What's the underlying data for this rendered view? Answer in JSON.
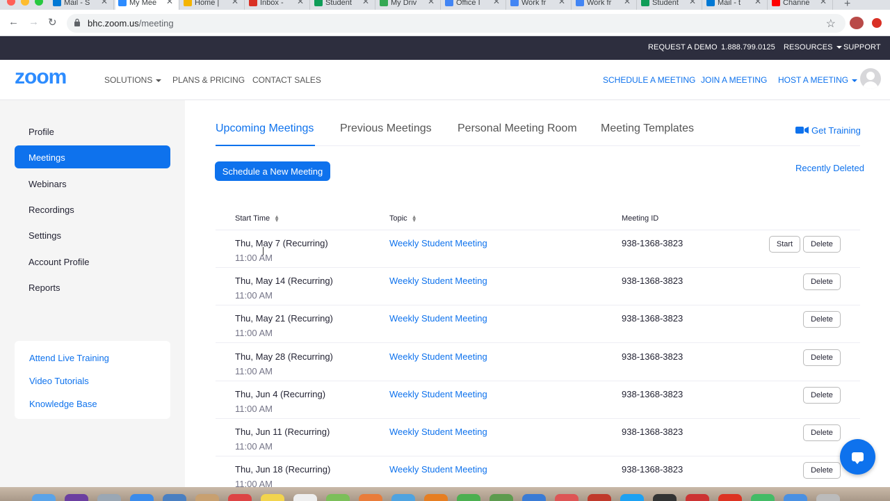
{
  "browser": {
    "tabs": [
      {
        "label": "Mail - S",
        "fav_color": "#0078d4",
        "active": false
      },
      {
        "label": "My Mee",
        "fav_color": "#2d8cff",
        "active": true
      },
      {
        "label": "Home |",
        "fav_color": "#f4b400",
        "active": false
      },
      {
        "label": "Inbox -",
        "fav_color": "#d93025",
        "active": false
      },
      {
        "label": "Student",
        "fav_color": "#0f9d58",
        "active": false
      },
      {
        "label": "My Driv",
        "fav_color": "#34a853",
        "active": false
      },
      {
        "label": "Office I",
        "fav_color": "#4285f4",
        "active": false
      },
      {
        "label": "Work fr",
        "fav_color": "#4285f4",
        "active": false
      },
      {
        "label": "Work fr",
        "fav_color": "#4285f4",
        "active": false
      },
      {
        "label": "Student",
        "fav_color": "#0f9d58",
        "active": false
      },
      {
        "label": "Mail - t",
        "fav_color": "#0078d4",
        "active": false
      },
      {
        "label": "Channe",
        "fav_color": "#ff0000",
        "active": false
      }
    ],
    "url_host": "bhc.zoom.us",
    "url_path": "/meeting"
  },
  "topbar": {
    "request_demo": "REQUEST A DEMO",
    "phone": "1.888.799.0125",
    "resources": "RESOURCES",
    "support": "SUPPORT"
  },
  "header": {
    "logo": "zoom",
    "solutions": "SOLUTIONS",
    "plans": "PLANS & PRICING",
    "contact": "CONTACT SALES",
    "schedule": "SCHEDULE A MEETING",
    "join": "JOIN A MEETING",
    "host": "HOST A MEETING"
  },
  "sidebar": {
    "items": [
      {
        "label": "Profile",
        "active": false
      },
      {
        "label": "Meetings",
        "active": true
      },
      {
        "label": "Webinars",
        "active": false
      },
      {
        "label": "Recordings",
        "active": false
      },
      {
        "label": "Settings",
        "active": false
      },
      {
        "label": "Account Profile",
        "active": false
      },
      {
        "label": "Reports",
        "active": false
      }
    ],
    "links": [
      "Attend Live Training",
      "Video Tutorials",
      "Knowledge Base"
    ]
  },
  "main": {
    "tabs": [
      "Upcoming Meetings",
      "Previous Meetings",
      "Personal Meeting Room",
      "Meeting Templates"
    ],
    "get_training": "Get Training",
    "recently_deleted": "Recently Deleted",
    "schedule_button": "Schedule a New Meeting",
    "columns": {
      "start_time": "Start Time",
      "topic": "Topic",
      "meeting_id": "Meeting ID"
    },
    "start_label": "Start",
    "delete_label": "Delete",
    "meetings": [
      {
        "date": "Thu, May 7 (Recurring)",
        "time": "11:00 AM",
        "topic": "Weekly Student Meeting",
        "id": "938-1368-3823",
        "show_start": true
      },
      {
        "date": "Thu, May 14 (Recurring)",
        "time": "11:00 AM",
        "topic": "Weekly Student Meeting",
        "id": "938-1368-3823",
        "show_start": false
      },
      {
        "date": "Thu, May 21 (Recurring)",
        "time": "11:00 AM",
        "topic": "Weekly Student Meeting",
        "id": "938-1368-3823",
        "show_start": false
      },
      {
        "date": "Thu, May 28 (Recurring)",
        "time": "11:00 AM",
        "topic": "Weekly Student Meeting",
        "id": "938-1368-3823",
        "show_start": false
      },
      {
        "date": "Thu, Jun 4 (Recurring)",
        "time": "11:00 AM",
        "topic": "Weekly Student Meeting",
        "id": "938-1368-3823",
        "show_start": false
      },
      {
        "date": "Thu, Jun 11 (Recurring)",
        "time": "11:00 AM",
        "topic": "Weekly Student Meeting",
        "id": "938-1368-3823",
        "show_start": false
      },
      {
        "date": "Thu, Jun 18 (Recurring)",
        "time": "11:00 AM",
        "topic": "Weekly Student Meeting",
        "id": "938-1368-3823",
        "show_start": false
      }
    ]
  },
  "colors": {
    "accent": "#0e72ed",
    "topbar": "#2d2e3e",
    "sidebar_bg": "#f5f5f5"
  },
  "icons": {
    "chat": "chat-bubble-icon",
    "camera": "video-camera-icon",
    "sort": "sort-arrows-icon"
  }
}
